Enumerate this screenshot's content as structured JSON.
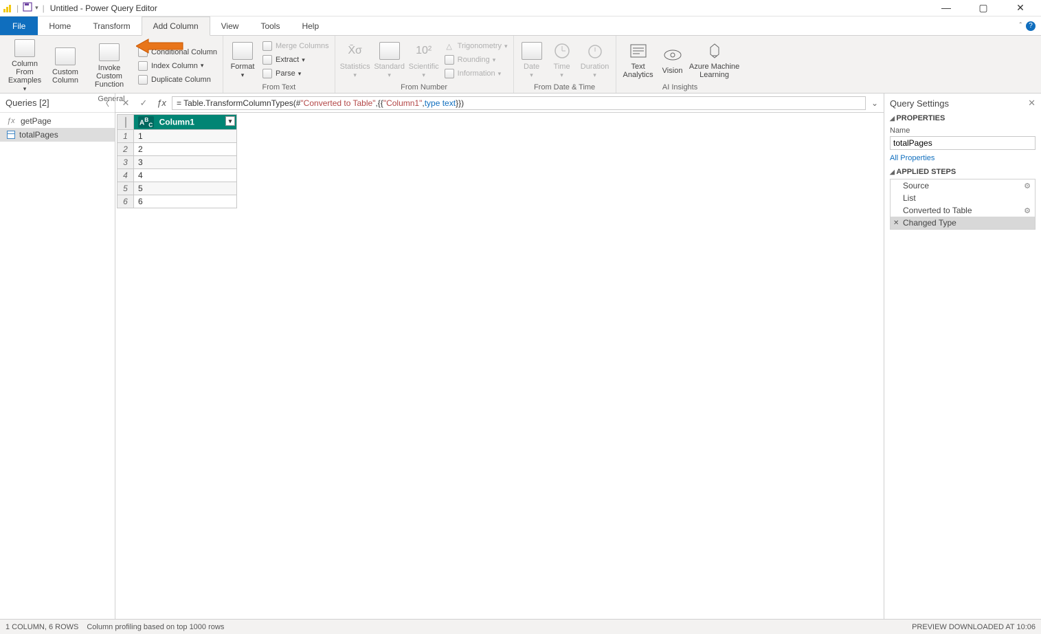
{
  "window": {
    "title": "Untitled - Power Query Editor"
  },
  "tabs": {
    "file": "File",
    "list": [
      "Home",
      "Transform",
      "Add Column",
      "View",
      "Tools",
      "Help"
    ],
    "active": "Add Column"
  },
  "ribbon": {
    "general": {
      "label": "General",
      "column_from_examples": "Column From\nExamples",
      "custom_column": "Custom\nColumn",
      "invoke_custom_function": "Invoke Custom\nFunction",
      "conditional_column": "Conditional Column",
      "index_column": "Index Column",
      "duplicate_column": "Duplicate Column"
    },
    "from_text": {
      "label": "From Text",
      "format": "Format",
      "merge_columns": "Merge Columns",
      "extract": "Extract",
      "parse": "Parse"
    },
    "from_number": {
      "label": "From Number",
      "statistics": "Statistics",
      "standard": "Standard",
      "scientific": "Scientific",
      "trigonometry": "Trigonometry",
      "rounding": "Rounding",
      "information": "Information"
    },
    "from_date_time": {
      "label": "From Date & Time",
      "date": "Date",
      "time": "Time",
      "duration": "Duration"
    },
    "ai_insights": {
      "label": "AI Insights",
      "text_analytics": "Text\nAnalytics",
      "vision": "Vision",
      "azure_ml": "Azure Machine\nLearning"
    }
  },
  "queries_panel": {
    "title": "Queries [2]",
    "items": [
      {
        "kind": "fx",
        "name": "getPage"
      },
      {
        "kind": "table",
        "name": "totalPages",
        "selected": true
      }
    ]
  },
  "formula": {
    "prefix": "= Table.TransformColumnTypes(#",
    "str1": "\"Converted to Table\"",
    "mid1": ",{{",
    "str2": "\"Column1\"",
    "mid2": ", ",
    "kw": "type text",
    "suffix": "}})"
  },
  "grid": {
    "column_header": "Column1",
    "rows": [
      "1",
      "2",
      "3",
      "4",
      "5",
      "6"
    ]
  },
  "settings": {
    "title": "Query Settings",
    "properties_label": "PROPERTIES",
    "name_label": "Name",
    "name_value": "totalPages",
    "all_properties": "All Properties",
    "applied_steps_label": "APPLIED STEPS",
    "steps": [
      {
        "name": "Source",
        "gear": true
      },
      {
        "name": "List",
        "gear": false
      },
      {
        "name": "Converted to Table",
        "gear": true
      },
      {
        "name": "Changed Type",
        "gear": false,
        "selected": true
      }
    ]
  },
  "status": {
    "left1": "1 COLUMN, 6 ROWS",
    "left2": "Column profiling based on top 1000 rows",
    "right": "PREVIEW DOWNLOADED AT 10:06"
  }
}
